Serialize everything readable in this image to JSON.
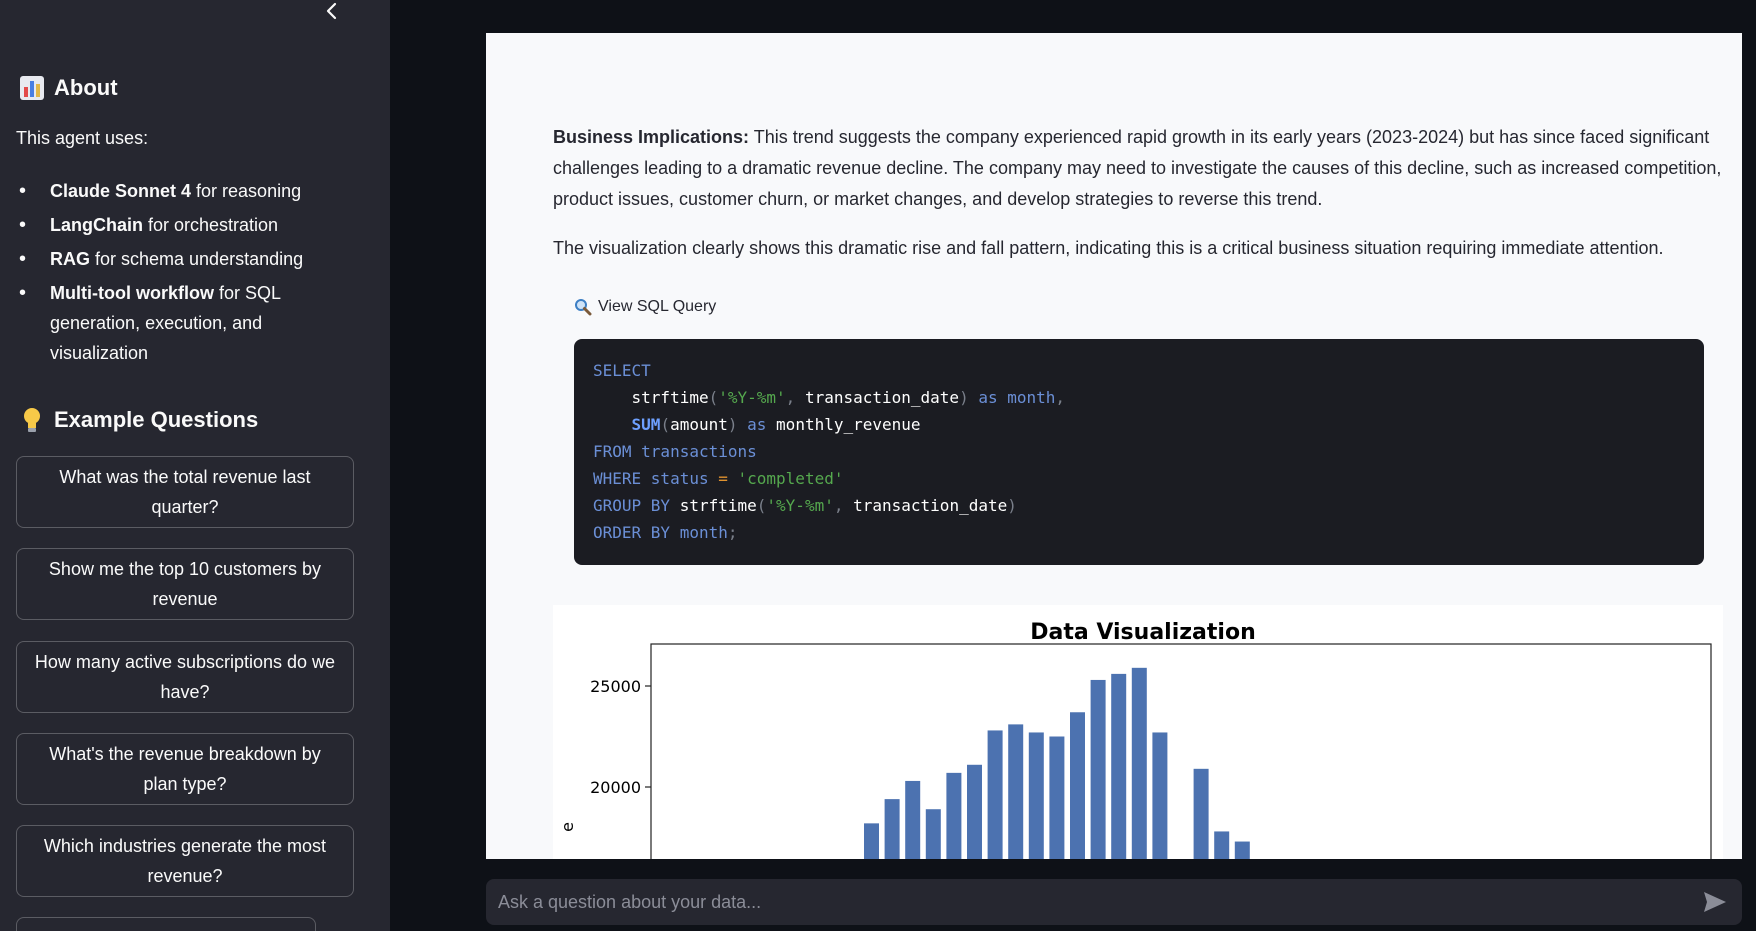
{
  "sidebar": {
    "about": {
      "emoji": "bar-chart-icon",
      "title": "About"
    },
    "uses_text": "This agent uses:",
    "features": [
      {
        "bold": "Claude Sonnet 4",
        "rest": " for reasoning"
      },
      {
        "bold": "LangChain",
        "rest": " for orchestration"
      },
      {
        "bold": "RAG",
        "rest": " for schema understanding"
      },
      {
        "bold": "Multi-tool workflow",
        "rest": " for SQL generation, execution, and visualization"
      }
    ],
    "examples": {
      "emoji": "lightbulb-icon",
      "title": "Example Questions"
    },
    "example_buttons": [
      "What was the total revenue last quarter?",
      "Show me the top 10 customers by revenue",
      "How many active subscriptions do we have?",
      "What's the revenue breakdown by plan type?",
      "Which industries generate the most revenue?",
      ""
    ]
  },
  "main": {
    "implications_label": "Business Implications:",
    "implications_text": " This trend suggests the company experienced rapid growth in its early years (2023-2024) but has since faced significant challenges leading to a dramatic revenue decline. The company may need to investigate the causes of this decline, such as increased competition, product issues, customer churn, or market changes, and develop strategies to reverse this trend.",
    "visualization_text": "The visualization clearly shows this dramatic rise and fall pattern, indicating this is a critical business situation requiring immediate attention.",
    "sql_toggle_label": "View SQL Query",
    "sql_lines": [
      [
        [
          "kw",
          "SELECT"
        ]
      ],
      [
        [
          "plain",
          "    strftime"
        ],
        [
          "punc",
          "("
        ],
        [
          "str",
          "'%Y-%m'"
        ],
        [
          "punc",
          ", "
        ],
        [
          "plain",
          "transaction_date"
        ],
        [
          "punc",
          ")"
        ],
        [
          "kw",
          " as month"
        ],
        [
          "punc",
          ","
        ]
      ],
      [
        [
          "fn",
          "    SUM"
        ],
        [
          "punc",
          "("
        ],
        [
          "plain",
          "amount"
        ],
        [
          "punc",
          ")"
        ],
        [
          "kw",
          " as "
        ],
        [
          "plain",
          "monthly_revenue"
        ]
      ],
      [
        [
          "kw",
          "FROM transactions"
        ]
      ],
      [
        [
          "kw",
          "WHERE status "
        ],
        [
          "op",
          "="
        ],
        [
          "str",
          " 'completed'"
        ]
      ],
      [
        [
          "kw",
          "GROUP BY "
        ],
        [
          "plain",
          "strftime"
        ],
        [
          "punc",
          "("
        ],
        [
          "str",
          "'%Y-%m'"
        ],
        [
          "punc",
          ", "
        ],
        [
          "plain",
          "transaction_date"
        ],
        [
          "punc",
          ")"
        ]
      ],
      [
        [
          "kw",
          "ORDER BY month"
        ],
        [
          "punc",
          ";"
        ]
      ]
    ]
  },
  "chart_data": {
    "type": "bar",
    "title": "Data Visualization",
    "ylabel": "e",
    "yticks": [
      20000,
      25000
    ],
    "ylim": [
      17000,
      27200
    ],
    "bar_color": "#4c72b0",
    "values": [
      null,
      null,
      null,
      null,
      null,
      null,
      null,
      null,
      null,
      null,
      null,
      null,
      18200,
      19400,
      20300,
      18900,
      20700,
      21100,
      22800,
      23100,
      22700,
      22500,
      23700,
      25300,
      25600,
      25900,
      22700,
      null,
      20900,
      17800,
      17300
    ]
  },
  "chat": {
    "placeholder": "Ask a question about your data..."
  },
  "colors": {
    "sidebar_bg": "#262730",
    "app_bg": "#0e1117",
    "panel_bg": "#f8f9fb",
    "bar": "#4c72b0"
  }
}
